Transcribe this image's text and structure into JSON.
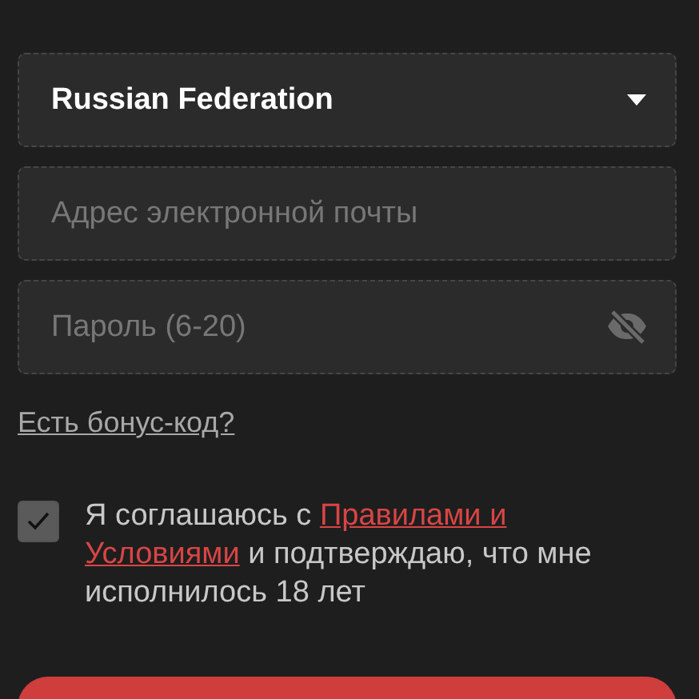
{
  "country_select": {
    "value": "Russian Federation"
  },
  "email_field": {
    "placeholder": "Адрес электронной почты"
  },
  "password_field": {
    "placeholder": "Пароль (6-20)",
    "visible": false
  },
  "bonus_link": {
    "label": "Есть бонус-код?"
  },
  "terms": {
    "checked": true,
    "parts": [
      {
        "kind": "text",
        "text": "Я соглашаюсь с "
      },
      {
        "kind": "link",
        "text": "Правилами и"
      },
      {
        "kind": "link",
        "text": "Условиями"
      },
      {
        "kind": "text",
        "text": " и подтверждаю, что мне исполнилось 18 лет"
      }
    ]
  },
  "submit_button": {
    "kind": "primary"
  }
}
